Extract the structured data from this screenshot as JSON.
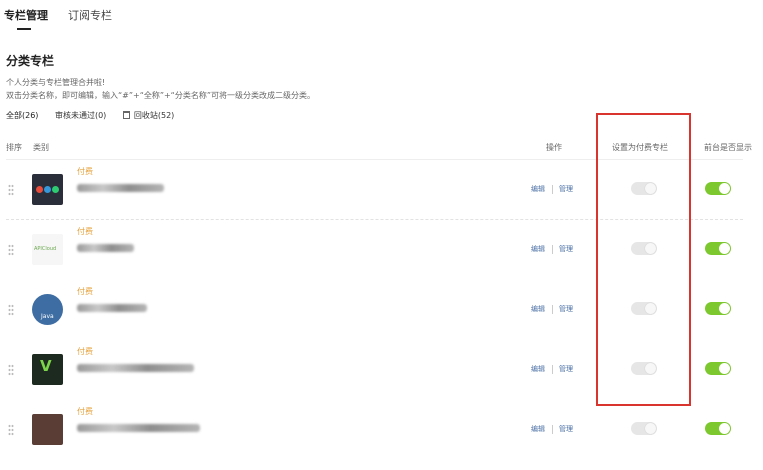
{
  "tabs": [
    {
      "label": "专栏管理",
      "active": true
    },
    {
      "label": "订阅专栏",
      "active": false
    }
  ],
  "section_title": "分类专栏",
  "description": [
    "个人分类与专栏管理合并啦!",
    "双击分类名称，即可编辑，输入“#”+“全称”+“分类名称”可将一级分类改成二级分类。"
  ],
  "filters": {
    "all": "全部(26)",
    "rejected": "审核未通过(0)",
    "trash": "回收站(52)"
  },
  "columns": {
    "sort": "排序",
    "category": "类别",
    "operation": "操作",
    "paid": "设置为付费专栏",
    "show": "前台是否显示"
  },
  "rows": [
    {
      "tag": "付费",
      "thumb": "colored-dots",
      "paid_on": false,
      "show_on": true
    },
    {
      "tag": "付费",
      "thumb": "cloud-logo",
      "thumb_text": "APICloud",
      "paid_on": false,
      "show_on": true
    },
    {
      "tag": "付费",
      "thumb": "java-logo",
      "thumb_text": "Java",
      "paid_on": false,
      "show_on": true
    },
    {
      "tag": "付费",
      "thumb": "v-logo",
      "thumb_text": "V",
      "paid_on": false,
      "show_on": true
    },
    {
      "tag": "付费",
      "thumb": "photo",
      "paid_on": false,
      "show_on": true
    }
  ],
  "actions": {
    "edit": "编辑",
    "manage": "管理"
  },
  "colors": {
    "accent_green": "#7cc82e",
    "paid_tag": "#e6a23c",
    "highlight_border": "#d9352e",
    "link": "#4a6fa5"
  }
}
